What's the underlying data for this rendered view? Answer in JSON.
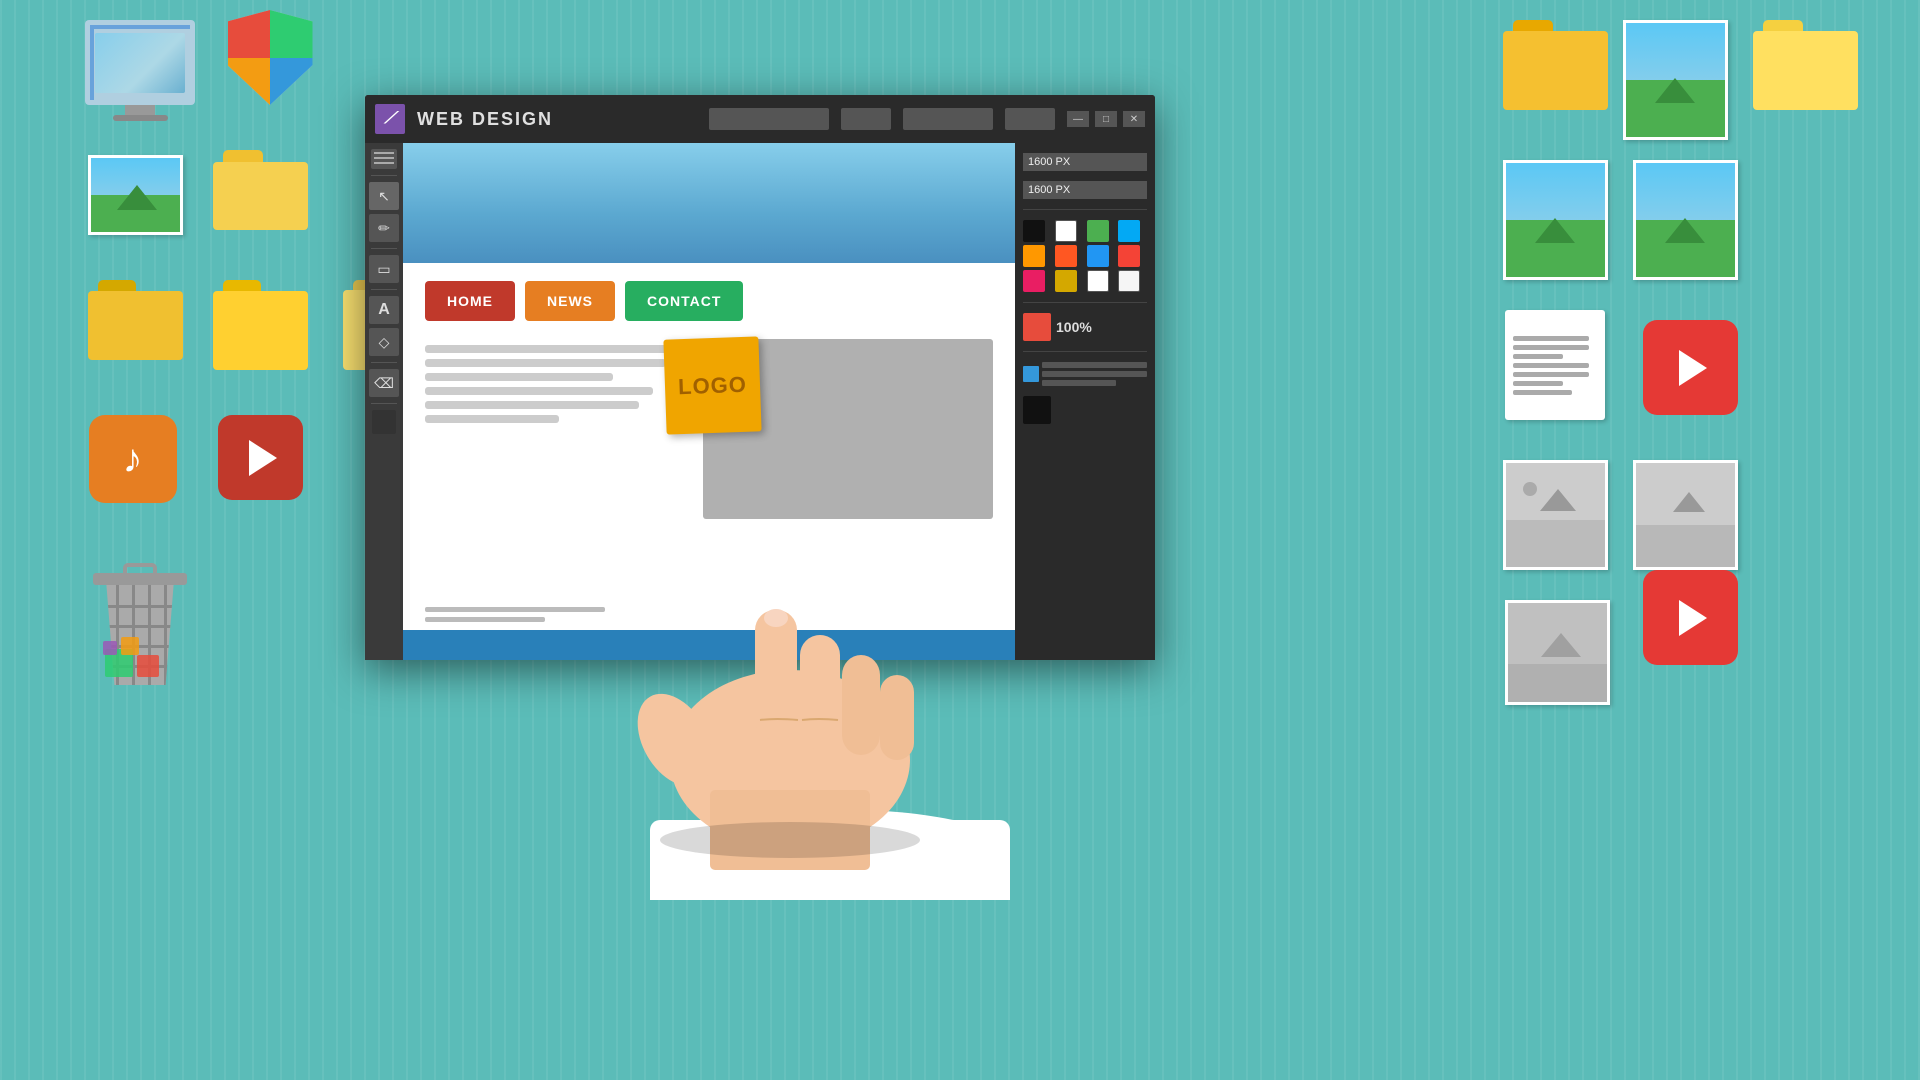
{
  "app": {
    "title": "WEB DESIGN",
    "icon_symbol": "⟋",
    "controls": {
      "minimize": "—",
      "maximize": "□",
      "close": "✕"
    },
    "toolbar_inputs": [
      "",
      "",
      "",
      ""
    ],
    "right_panel": {
      "width_label": "1600 PX",
      "height_label": "1600 PX",
      "zoom": "100%",
      "colors_row1": [
        "#ffffff",
        "#4caf50",
        "#03a9f4",
        "#2196f3"
      ],
      "colors_row2": [
        "#ff9800",
        "#ff5722",
        "#2196f3",
        "#f44336"
      ],
      "colors_row3": [
        "#e91e63",
        "#9c27b0",
        "#ffffff",
        "#f5f5f5"
      ]
    },
    "design": {
      "nav": {
        "home": "HOME",
        "news": "NEWS",
        "contact": "CONTACT"
      },
      "logo_label": "LOGO",
      "footer_color": "#2980b9"
    }
  },
  "desktop": {
    "bg_color": "#5bbcb8"
  }
}
